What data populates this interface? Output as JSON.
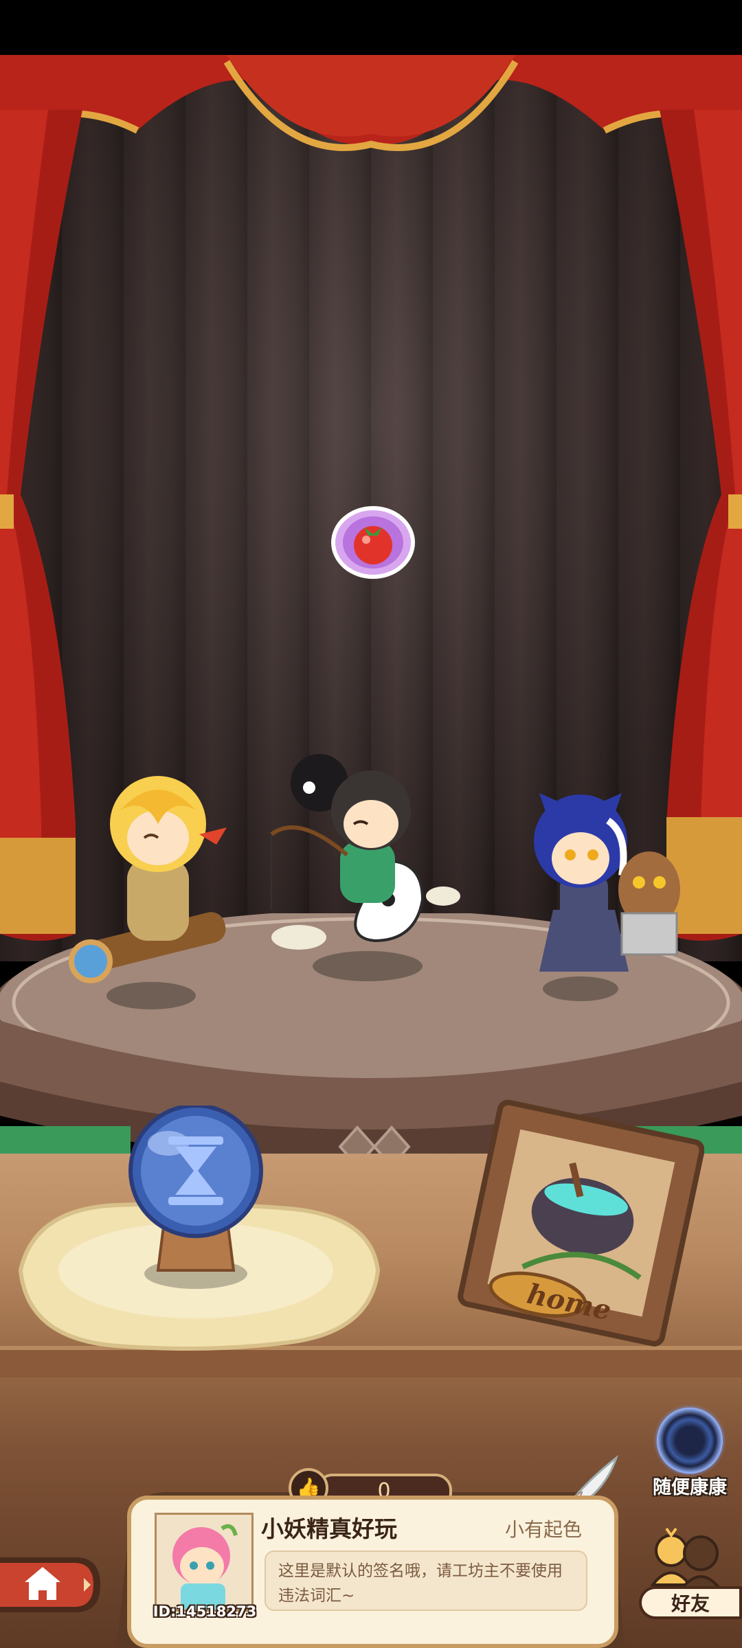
{
  "scene": {
    "floating_item_icon": "tomato-bubble-icon",
    "characters": [
      {
        "id": "blonde-boy-on-telescope"
      },
      {
        "id": "fisher-boy-on-yin-yang"
      },
      {
        "id": "blue-cat-girl-with-spirit"
      }
    ],
    "orb_icon": "hourglass-icon",
    "home_frame_label": "home"
  },
  "random_visit": {
    "label": "随便康康",
    "icon": "portal-ring-icon"
  },
  "likes": {
    "count": "0",
    "icon": "thumbs-up-icon"
  },
  "profile": {
    "name": "小妖精真好玩",
    "title": "小有起色",
    "signature": "这里是默认的签名哦，请工坊主不要使用违法词汇~",
    "id_text": "ID:14518273"
  },
  "nav": {
    "home_icon": "house-icon",
    "friends_label": "好友",
    "friends_icon": "friends-icon"
  },
  "colors": {
    "curtain_red": "#b8231a",
    "curtain_gold": "#e3a741",
    "card_bg": "#fbf2de",
    "text_dark": "#3a2418"
  }
}
